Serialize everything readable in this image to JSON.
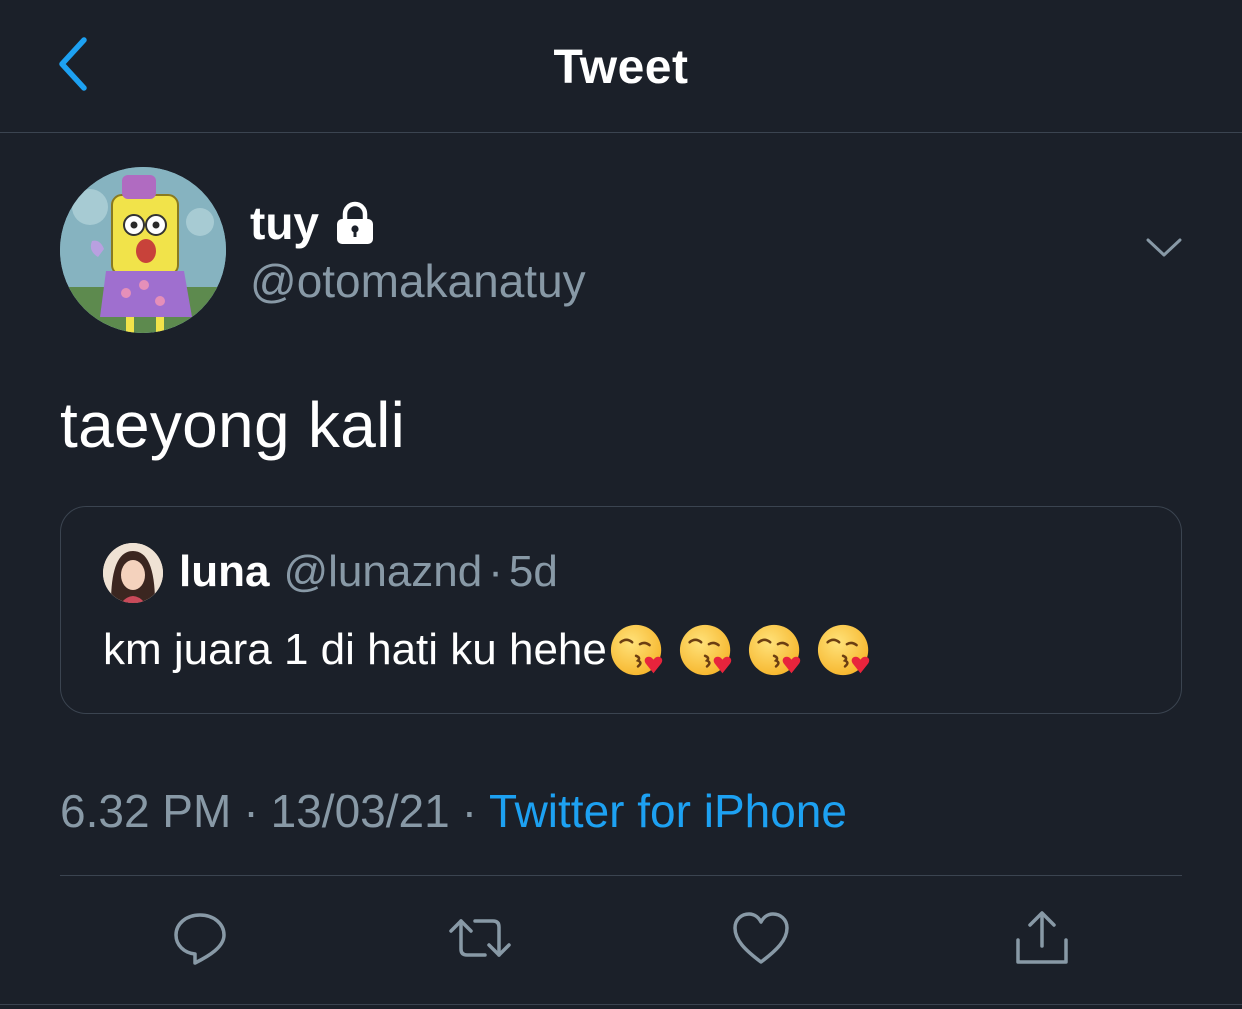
{
  "header": {
    "title": "Tweet",
    "back_icon": "chevron-left-icon"
  },
  "author": {
    "name": "tuy",
    "handle": "@otomakanatuy",
    "protected_icon": "lock-icon",
    "avatar": "avatar-image"
  },
  "tweet": {
    "text": "taeyong kali"
  },
  "quote": {
    "name": "luna",
    "handle": "@lunaznd",
    "separator": "·",
    "age": "5d",
    "text": "km juara 1 di hati ku hehe",
    "emojis": [
      "kissing-face-with-heart",
      "kissing-face-with-heart",
      "kissing-face-with-heart",
      "kissing-face-with-heart"
    ]
  },
  "meta": {
    "time": "6.32 PM",
    "separator": "·",
    "date": "13/03/21",
    "source": "Twitter for iPhone"
  },
  "actions": [
    "reply-icon",
    "retweet-icon",
    "like-icon",
    "share-icon"
  ],
  "colors": {
    "background": "#1b2029",
    "accent": "#1da1f2",
    "secondary_text": "#8899a6",
    "divider": "#3b4450"
  }
}
